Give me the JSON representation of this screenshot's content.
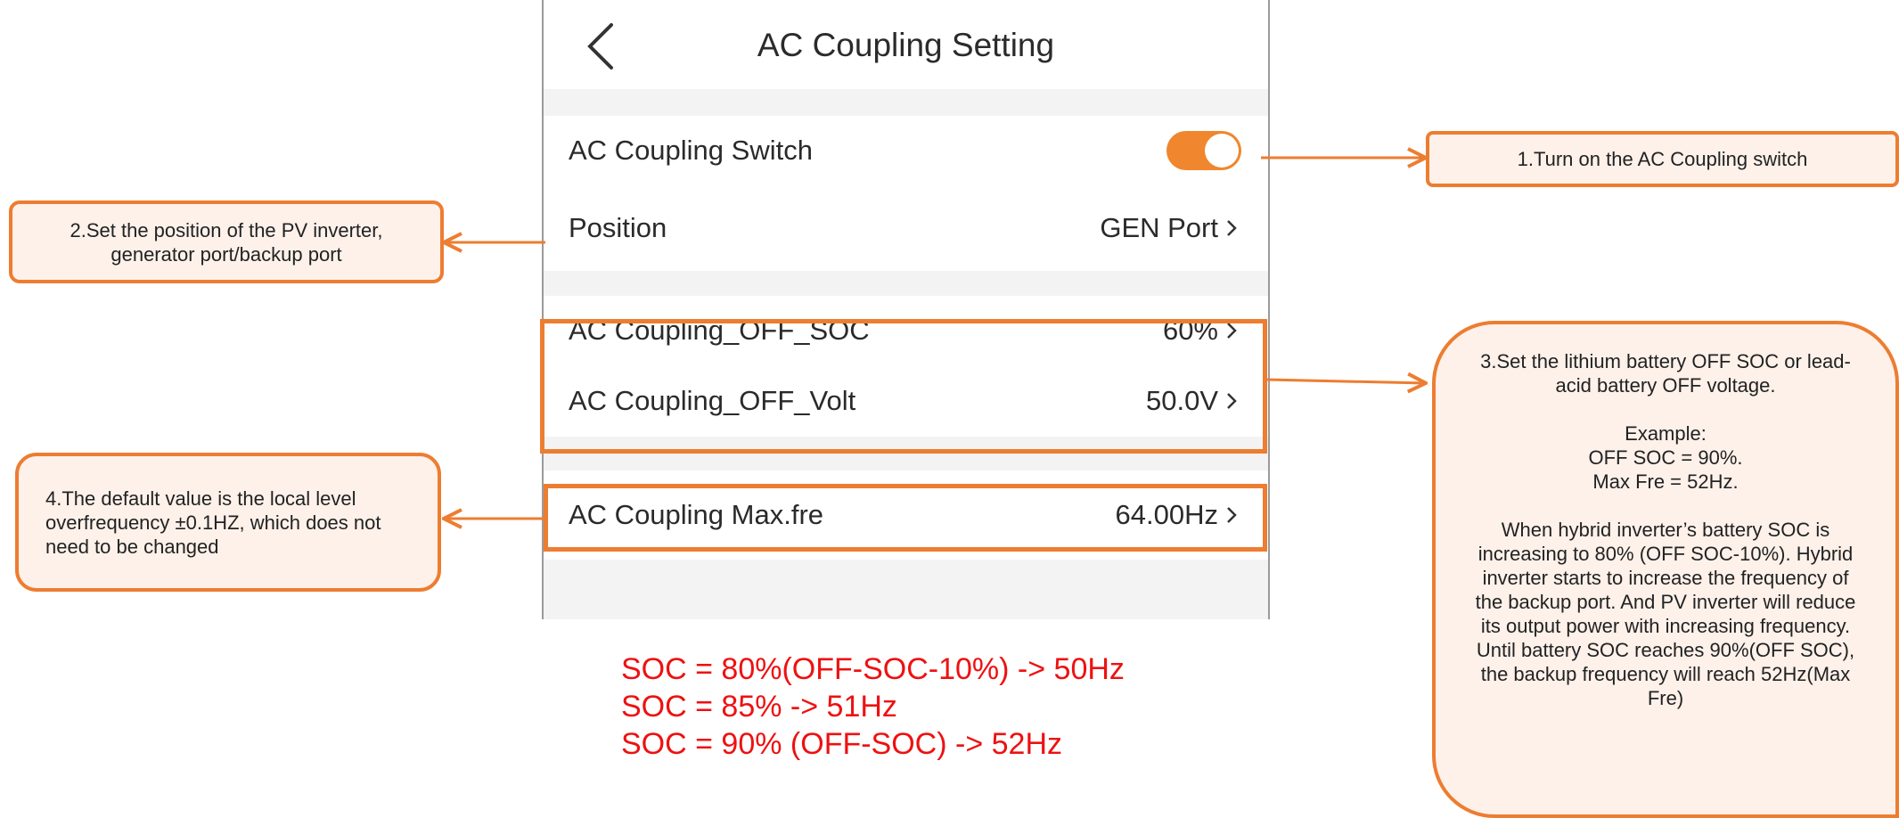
{
  "screen": {
    "title": "AC Coupling Setting",
    "rows": [
      {
        "label": "AC Coupling Switch",
        "toggle": "on"
      },
      {
        "label": "Position",
        "value": "GEN Port"
      },
      {
        "label": "AC Coupling_OFF_SOC",
        "value": "60%"
      },
      {
        "label": "AC Coupling_OFF_Volt",
        "value": "50.0V"
      },
      {
        "label": "AC Coupling Max.fre",
        "value": "64.00Hz"
      }
    ]
  },
  "callouts": {
    "c1": "1.Turn on the AC Coupling switch",
    "c2": "2.Set the position of the PV inverter, generator port/backup port",
    "c3": "3.Set the lithium battery OFF SOC or lead-acid battery OFF voltage.\n\nExample:\nOFF SOC = 90%.\nMax Fre = 52Hz.\n\nWhen hybrid inverter’s battery SOC is increasing to 80% (OFF SOC-10%). Hybrid inverter starts to increase the frequency of the backup port. And PV inverter will reduce its output power with increasing frequency.  Until battery SOC reaches 90%(OFF SOC), the backup frequency will reach 52Hz(Max Fre)",
    "c4": "4.The default value is the local level overfrequency ±0.1HZ, which does not need to be changed"
  },
  "formula": [
    "SOC =  80%(OFF-SOC-10%) -> 50Hz",
    "SOC = 85% -> 51Hz",
    "SOC = 90% (OFF-SOC) -> 52Hz"
  ],
  "colors": {
    "accent": "#ed7d31",
    "toggle": "#f0862d",
    "formula": "#ee1111",
    "callout_bg": "#fdf1ea"
  }
}
